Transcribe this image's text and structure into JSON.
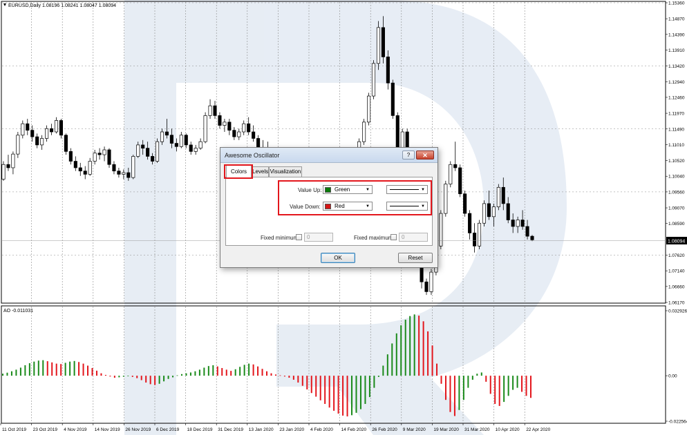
{
  "header": {
    "symbol_info": "EURUSD,Daily  1.08196 1.08241 1.08047 1.08094",
    "ao_info": "AO -0.011031"
  },
  "price_axis": {
    "labels": [
      "1.15360",
      "1.14870",
      "1.14390",
      "1.13910",
      "1.13420",
      "1.12940",
      "1.12460",
      "1.11970",
      "1.11490",
      "1.11010",
      "1.10520",
      "1.10040",
      "1.09560",
      "1.09070",
      "1.08590",
      "1.07620",
      "1.07140",
      "1.06660",
      "1.06170"
    ],
    "current_price": "1.08094"
  },
  "ao_axis": {
    "labels": [
      "0.032926",
      "0.00",
      "-0.022564"
    ]
  },
  "date_axis": {
    "labels": [
      "11 Oct 2019",
      "23 Oct 2019",
      "4 Nov 2019",
      "14 Nov 2019",
      "26 Nov 2019",
      "6 Dec 2019",
      "18 Dec 2019",
      "31 Dec 2019",
      "13 Jan 2020",
      "23 Jan 2020",
      "4 Feb 2020",
      "14 Feb 2020",
      "26 Feb 2020",
      "9 Mar 2020",
      "19 Mar 2020",
      "31 Mar 2020",
      "10 Apr 2020",
      "22 Apr 2020"
    ]
  },
  "colors": {
    "bull": "#ffffff",
    "bear": "#000000",
    "ao_up": "#1a8a1a",
    "ao_down": "#e3161c",
    "grid": "#8a8a8a",
    "highlight": "#e3161c"
  },
  "chart_data": [
    {
      "type": "candlestick",
      "title": "EURUSD,Daily",
      "ylim": [
        1.0617,
        1.1536
      ],
      "ohlc": [
        [
          1.0995,
          1.105,
          1.099,
          1.104
        ],
        [
          1.104,
          1.107,
          1.102,
          1.103
        ],
        [
          1.103,
          1.108,
          1.101,
          1.1072
        ],
        [
          1.1072,
          1.114,
          1.106,
          1.113
        ],
        [
          1.113,
          1.1175,
          1.112,
          1.1165
        ],
        [
          1.1165,
          1.118,
          1.113,
          1.1145
        ],
        [
          1.1145,
          1.116,
          1.111,
          1.1125
        ],
        [
          1.1125,
          1.1135,
          1.109,
          1.11
        ],
        [
          1.11,
          1.113,
          1.1085,
          1.112
        ],
        [
          1.112,
          1.116,
          1.111,
          1.115
        ],
        [
          1.115,
          1.1165,
          1.113,
          1.114
        ],
        [
          1.114,
          1.1185,
          1.1135,
          1.1175
        ],
        [
          1.1175,
          1.118,
          1.112,
          1.113
        ],
        [
          1.113,
          1.1135,
          1.107,
          1.108
        ],
        [
          1.108,
          1.109,
          1.104,
          1.105
        ],
        [
          1.105,
          1.1065,
          1.102,
          1.103
        ],
        [
          1.103,
          1.1045,
          1.1005,
          1.102
        ],
        [
          1.102,
          1.1035,
          1.0995,
          1.101
        ],
        [
          1.101,
          1.106,
          1.1005,
          1.105
        ],
        [
          1.105,
          1.1085,
          1.104,
          1.1075
        ],
        [
          1.1075,
          1.109,
          1.1055,
          1.107
        ],
        [
          1.107,
          1.1095,
          1.105,
          1.1085
        ],
        [
          1.1085,
          1.109,
          1.103,
          1.104
        ],
        [
          1.104,
          1.105,
          1.101,
          1.102
        ],
        [
          1.102,
          1.103,
          1.1,
          1.101
        ],
        [
          1.101,
          1.1025,
          1.0995,
          1.1015
        ],
        [
          1.1015,
          1.103,
          1.099,
          1.1
        ],
        [
          1.1,
          1.107,
          1.0995,
          1.1065
        ],
        [
          1.1065,
          1.111,
          1.106,
          1.11
        ],
        [
          1.11,
          1.1115,
          1.107,
          1.109
        ],
        [
          1.109,
          1.111,
          1.1055,
          1.1065
        ],
        [
          1.1065,
          1.1075,
          1.104,
          1.105
        ],
        [
          1.105,
          1.112,
          1.1045,
          1.111
        ],
        [
          1.111,
          1.115,
          1.11,
          1.114
        ],
        [
          1.114,
          1.118,
          1.112,
          1.113
        ],
        [
          1.113,
          1.115,
          1.109,
          1.1105
        ],
        [
          1.1105,
          1.112,
          1.108,
          1.1095
        ],
        [
          1.1095,
          1.114,
          1.109,
          1.113
        ],
        [
          1.113,
          1.1135,
          1.109,
          1.11
        ],
        [
          1.11,
          1.111,
          1.107,
          1.108
        ],
        [
          1.108,
          1.11,
          1.107,
          1.109
        ],
        [
          1.109,
          1.112,
          1.1085,
          1.111
        ],
        [
          1.111,
          1.12,
          1.1105,
          1.119
        ],
        [
          1.119,
          1.124,
          1.118,
          1.122
        ],
        [
          1.122,
          1.1235,
          1.118,
          1.119
        ],
        [
          1.119,
          1.12,
          1.115,
          1.116
        ],
        [
          1.116,
          1.118,
          1.114,
          1.117
        ],
        [
          1.117,
          1.118,
          1.113,
          1.1145
        ],
        [
          1.1145,
          1.1155,
          1.1115,
          1.1125
        ],
        [
          1.1125,
          1.115,
          1.1115,
          1.114
        ],
        [
          1.114,
          1.1175,
          1.113,
          1.1165
        ],
        [
          1.1165,
          1.1185,
          1.113,
          1.114
        ],
        [
          1.114,
          1.116,
          1.111,
          1.112
        ],
        [
          1.112,
          1.113,
          1.108,
          1.109
        ],
        [
          1.109,
          1.1115,
          1.107,
          1.108
        ],
        [
          1.108,
          1.111,
          1.106,
          1.1075
        ],
        [
          1.1075,
          1.108,
          1.104,
          1.105
        ],
        [
          1.105,
          1.106,
          1.101,
          1.102
        ],
        [
          1.102,
          1.1035,
          1.0985,
          1.0995
        ],
        [
          1.0995,
          1.1,
          1.095,
          1.096
        ],
        [
          1.096,
          1.0975,
          1.092,
          1.093
        ],
        [
          1.093,
          1.0945,
          1.09,
          1.091
        ],
        [
          1.091,
          1.092,
          1.087,
          1.088
        ],
        [
          1.088,
          1.089,
          1.084,
          1.085
        ],
        [
          1.085,
          1.086,
          1.081,
          1.082
        ],
        [
          1.082,
          1.0835,
          1.0785,
          1.08
        ],
        [
          1.08,
          1.081,
          1.076,
          1.078
        ],
        [
          1.078,
          1.08,
          1.077,
          1.079
        ],
        [
          1.079,
          1.083,
          1.0785,
          1.0825
        ],
        [
          1.0825,
          1.085,
          1.081,
          1.084
        ],
        [
          1.084,
          1.088,
          1.083,
          1.087
        ],
        [
          1.087,
          1.09,
          1.0855,
          1.089
        ],
        [
          1.089,
          1.096,
          1.088,
          1.095
        ],
        [
          1.095,
          1.105,
          1.094,
          1.104
        ],
        [
          1.104,
          1.112,
          1.103,
          1.111
        ],
        [
          1.111,
          1.118,
          1.11,
          1.117
        ],
        [
          1.117,
          1.126,
          1.116,
          1.125
        ],
        [
          1.125,
          1.136,
          1.124,
          1.135
        ],
        [
          1.135,
          1.148,
          1.133,
          1.146
        ],
        [
          1.146,
          1.1495,
          1.135,
          1.137
        ],
        [
          1.137,
          1.139,
          1.127,
          1.129
        ],
        [
          1.129,
          1.13,
          1.118,
          1.119
        ],
        [
          1.119,
          1.12,
          1.107,
          1.109
        ],
        [
          1.109,
          1.115,
          1.106,
          1.114
        ],
        [
          1.114,
          1.115,
          1.1,
          1.101
        ],
        [
          1.101,
          1.102,
          1.088,
          1.089
        ],
        [
          1.089,
          1.09,
          1.074,
          1.076
        ],
        [
          1.076,
          1.077,
          1.066,
          1.068
        ],
        [
          1.068,
          1.069,
          1.064,
          1.065
        ],
        [
          1.065,
          1.072,
          1.064,
          1.071
        ],
        [
          1.071,
          1.08,
          1.07,
          1.079
        ],
        [
          1.079,
          1.09,
          1.078,
          1.089
        ],
        [
          1.089,
          1.099,
          1.088,
          1.098
        ],
        [
          1.098,
          1.105,
          1.097,
          1.104
        ],
        [
          1.104,
          1.111,
          1.102,
          1.103
        ],
        [
          1.103,
          1.104,
          1.094,
          1.095
        ],
        [
          1.095,
          1.096,
          1.088,
          1.089
        ],
        [
          1.089,
          1.09,
          1.081,
          1.083
        ],
        [
          1.083,
          1.086,
          1.077,
          1.079
        ],
        [
          1.079,
          1.087,
          1.078,
          1.086
        ],
        [
          1.086,
          1.093,
          1.085,
          1.092
        ],
        [
          1.092,
          1.096,
          1.087,
          1.088
        ],
        [
          1.088,
          1.092,
          1.085,
          1.091
        ],
        [
          1.091,
          1.098,
          1.09,
          1.097
        ],
        [
          1.097,
          1.1,
          1.09,
          1.092
        ],
        [
          1.092,
          1.094,
          1.086,
          1.087
        ],
        [
          1.087,
          1.089,
          1.083,
          1.085
        ],
        [
          1.085,
          1.088,
          1.083,
          1.087
        ],
        [
          1.087,
          1.09,
          1.084,
          1.085
        ],
        [
          1.085,
          1.087,
          1.081,
          1.082
        ],
        [
          1.082,
          1.0824,
          1.0805,
          1.0809
        ]
      ]
    },
    {
      "type": "bar",
      "title": "AO",
      "ylim": [
        -0.022564,
        0.032926
      ],
      "values": [
        0.001,
        0.0015,
        0.0022,
        0.003,
        0.004,
        0.0052,
        0.0062,
        0.007,
        0.0075,
        0.0077,
        0.0072,
        0.0066,
        0.006,
        0.0058,
        0.0064,
        0.007,
        0.0073,
        0.0068,
        0.006,
        0.005,
        0.0038,
        0.0025,
        0.0012,
        0.0004,
        -0.0004,
        -0.001,
        -0.0008,
        -0.0005,
        -0.0002,
        -0.0006,
        -0.0012,
        -0.0022,
        -0.0034,
        -0.0042,
        -0.0046,
        -0.004,
        -0.0028,
        -0.0016,
        -0.0008,
        0.0002,
        0.0008,
        0.0012,
        0.0016,
        0.0022,
        0.003,
        0.004,
        0.0048,
        0.0052,
        0.0046,
        0.0038,
        0.003,
        0.0024,
        0.0032,
        0.0044,
        0.0054,
        0.006,
        0.0056,
        0.0046,
        0.0034,
        0.0022,
        0.0012,
        0.0006,
        0.0002,
        -0.0004,
        -0.001,
        -0.002,
        -0.0034,
        -0.005,
        -0.0068,
        -0.0086,
        -0.0104,
        -0.0122,
        -0.014,
        -0.0158,
        -0.0174,
        -0.0188,
        -0.0198,
        -0.0202,
        -0.0196,
        -0.0184,
        -0.0166,
        -0.014,
        -0.0106,
        -0.006,
        -0.0006,
        0.005,
        0.0106,
        0.016,
        0.021,
        0.025,
        0.0278,
        0.0296,
        0.0304,
        0.0298,
        0.027,
        0.022,
        0.015,
        0.006,
        -0.004,
        -0.012,
        -0.018,
        -0.02,
        -0.017,
        -0.012,
        -0.006,
        -0.002,
        0.001,
        0.0016,
        -0.003,
        -0.009,
        -0.014,
        -0.015,
        -0.013,
        -0.01,
        -0.007,
        -0.006,
        -0.008,
        -0.01,
        -0.011
      ]
    }
  ],
  "dialog": {
    "title": "Awesome Oscillator",
    "help_glyph": "?",
    "close_glyph": "✕",
    "tabs": [
      "Colors",
      "Levels",
      "Visualization"
    ],
    "value_up_label": "Value Up:",
    "value_up_color_name": "Green",
    "value_up_color": "#0b7a0b",
    "value_down_label": "Value Down:",
    "value_down_color_name": "Red",
    "value_down_color": "#d51515",
    "fixed_min_label": "Fixed minimum",
    "fixed_min_value": "0",
    "fixed_max_label": "Fixed maximum",
    "fixed_max_value": "0",
    "ok_label": "OK",
    "reset_label": "Reset"
  }
}
